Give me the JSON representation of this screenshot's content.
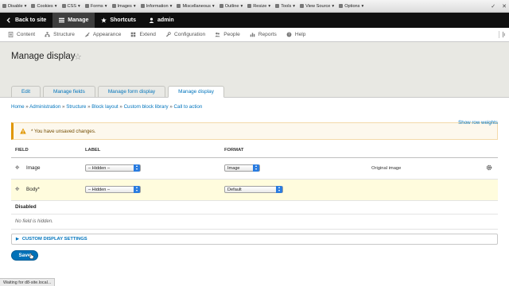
{
  "webdev_toolbar": {
    "items": [
      "Disable",
      "Cookies",
      "CSS",
      "Forms",
      "Images",
      "Information",
      "Miscellaneous",
      "Outline",
      "Resize",
      "Tools",
      "View Source",
      "Options"
    ],
    "close_glyph": "✓",
    "x_glyph": "✕"
  },
  "admin_toolbar": {
    "back_to_site": "Back to site",
    "manage": "Manage",
    "shortcuts": "Shortcuts",
    "user": "admin"
  },
  "admin_menu": {
    "items": [
      "Content",
      "Structure",
      "Appearance",
      "Extend",
      "Configuration",
      "People",
      "Reports",
      "Help"
    ],
    "icons": [
      "content-icon",
      "structure-icon",
      "appearance-icon",
      "extend-icon",
      "configuration-icon",
      "people-icon",
      "reports-icon",
      "help-icon"
    ]
  },
  "page": {
    "title": "Manage display",
    "star_glyph": "☆",
    "tabs": [
      {
        "label": "Edit",
        "active": false
      },
      {
        "label": "Manage fields",
        "active": false
      },
      {
        "label": "Manage form display",
        "active": false
      },
      {
        "label": "Manage display",
        "active": true
      }
    ]
  },
  "breadcrumb": [
    "Home",
    "Administration",
    "Structure",
    "Block layout",
    "Custom block library",
    "Call to action"
  ],
  "breadcrumb_separator": "»",
  "show_row_weights": "Show row weights",
  "warning": {
    "text": "* You have unsaved changes.",
    "color": "#e09600"
  },
  "table": {
    "headers": [
      "Field",
      "Label",
      "Format"
    ],
    "rows": [
      {
        "field": "Image",
        "label": "– Hidden –",
        "format": "Image",
        "summary": "Original image",
        "has_settings": true,
        "highlight": false
      },
      {
        "field": "Body*",
        "label": "– Hidden –",
        "format": "Default",
        "summary": "",
        "has_settings": false,
        "highlight": true
      }
    ],
    "disabled_region": "Disabled",
    "no_field_text": "No field is hidden."
  },
  "custom_display_settings": "Custom display settings",
  "save_label": "Save",
  "status_text": "Waiting for d8-site.local...",
  "colors": {
    "link": "#0074bd",
    "primary_button": "#0071b8",
    "highlight_row": "#fffcdd"
  }
}
